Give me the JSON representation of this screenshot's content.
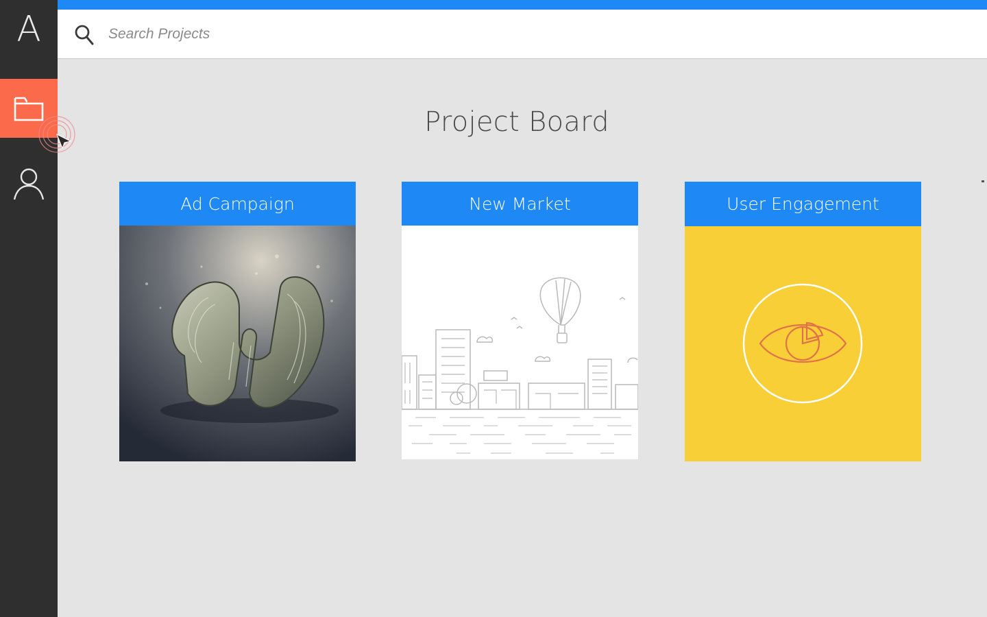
{
  "app": {
    "logo_letter": "A"
  },
  "sidebar": {
    "items": [
      {
        "name": "projects",
        "icon": "folder-icon",
        "active": true
      },
      {
        "name": "profile",
        "icon": "user-icon",
        "active": false
      }
    ],
    "active_color": "#fb6b4b",
    "background": "#2f2f2f"
  },
  "search": {
    "placeholder": "Search Projects",
    "value": ""
  },
  "main": {
    "title": "Project Board",
    "accent_color": "#1e88f5",
    "projects": [
      {
        "label": "Ad Campaign",
        "image": "money-image"
      },
      {
        "label": "New Market",
        "image": "city-skyline-image"
      },
      {
        "label": "User Engagement",
        "image": "eye-chart-image"
      }
    ]
  }
}
